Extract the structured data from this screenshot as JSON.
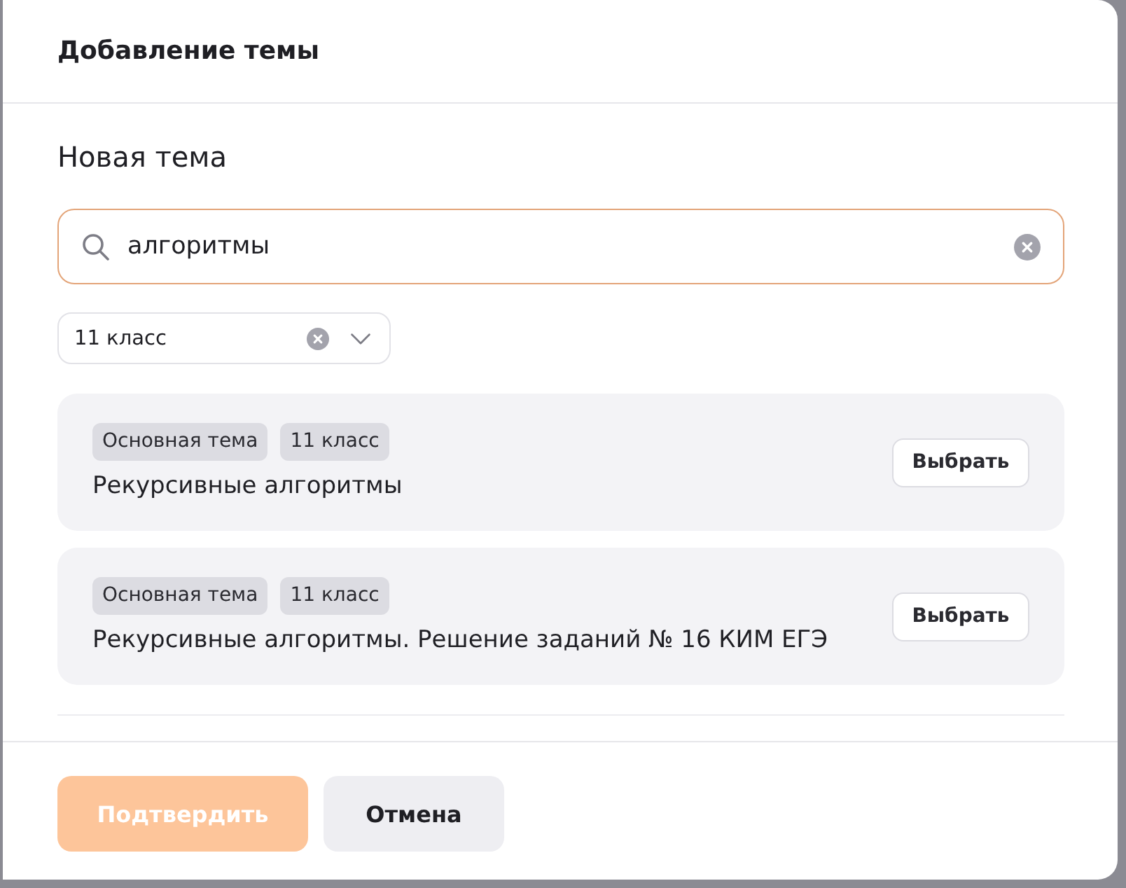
{
  "dialog": {
    "title": "Добавление темы"
  },
  "section_title": "Новая тема",
  "search": {
    "value": "алгоритмы"
  },
  "class_filter": {
    "value": "11 класс"
  },
  "results": [
    {
      "tags": [
        "Основная тема",
        "11 класс"
      ],
      "title": "Рекурсивные алгоритмы",
      "button": "Выбрать"
    },
    {
      "tags": [
        "Основная тема",
        "11 класс"
      ],
      "title": "Рекурсивные алгоритмы. Решение заданий № 16 КИМ ЕГЭ",
      "button": "Выбрать"
    }
  ],
  "footer_buttons": [
    {
      "label": "Подтвердить",
      "kind": "primary",
      "disabled": true
    },
    {
      "label": "Отмена",
      "kind": "secondary",
      "disabled": false
    }
  ]
}
